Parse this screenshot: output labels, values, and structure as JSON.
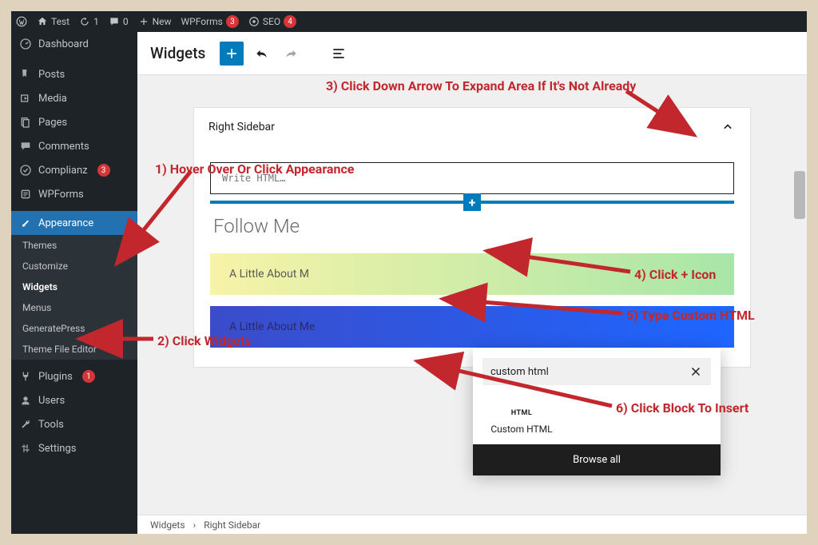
{
  "adminbar": {
    "site": "Test",
    "updates": "1",
    "comments": "0",
    "new": "New",
    "wpforms": "WPForms",
    "wpforms_count": "3",
    "seo": "SEO",
    "seo_count": "4"
  },
  "sidebar": {
    "items": [
      {
        "label": "Dashboard",
        "icon": "dashboard"
      },
      {
        "label": "Posts",
        "icon": "pin"
      },
      {
        "label": "Media",
        "icon": "media"
      },
      {
        "label": "Pages",
        "icon": "pages"
      },
      {
        "label": "Comments",
        "icon": "comments"
      },
      {
        "label": "Complianz",
        "icon": "check",
        "badge": "3"
      },
      {
        "label": "WPForms",
        "icon": "forms"
      },
      {
        "label": "Appearance",
        "icon": "brush",
        "active": true
      },
      {
        "label": "Plugins",
        "icon": "plug",
        "badge": "1"
      },
      {
        "label": "Users",
        "icon": "user"
      },
      {
        "label": "Tools",
        "icon": "wrench"
      },
      {
        "label": "Settings",
        "icon": "settings"
      }
    ],
    "submenu": [
      "Themes",
      "Customize",
      "Widgets",
      "Menus",
      "GeneratePress",
      "Theme File Editor"
    ],
    "submenu_current": "Widgets"
  },
  "page": {
    "title": "Widgets",
    "area_title": "Right Sidebar",
    "html_placeholder": "Write HTML…",
    "follow_heading": "Follow Me",
    "card1": "A Little About M",
    "card2": "A Little About Me"
  },
  "popup": {
    "search_value": "custom html",
    "block_label": "Custom HTML",
    "block_icon": "HTML",
    "browse_all": "Browse all"
  },
  "breadcrumb": {
    "a": "Widgets",
    "b": "Right Sidebar"
  },
  "annotations": {
    "a1": "1) Hover Over Or Click Appearance",
    "a2": "2) Click Widgets",
    "a3": "3) Click Down Arrow To Expand Area If It's Not Already",
    "a4": "4) Click + Icon",
    "a5": "5) Type Custom HTML",
    "a6": "6) Click Block To Insert"
  }
}
